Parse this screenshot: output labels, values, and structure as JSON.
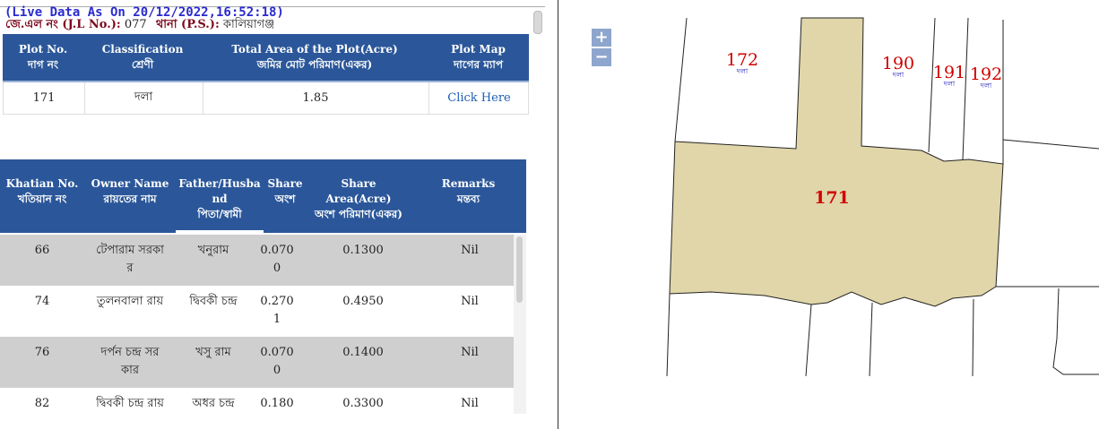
{
  "live_data": "(Live Data As On 20/12/2022,16:52:18)",
  "jl": {
    "jl_label": "জে.এল নং (J.L No.):",
    "jl_value": "077",
    "ps_label": "থানা (P.S.):",
    "ps_value": "কালিয়াগঞ্জ"
  },
  "plot_table": {
    "headers": [
      {
        "en": "Plot No.",
        "bn": "দাগ নং"
      },
      {
        "en": "Classification",
        "bn": "শ্রেণী"
      },
      {
        "en": "Total Area of the Plot(Acre)",
        "bn": "জমির মোট পরিমাণ(একর)"
      },
      {
        "en": "Plot Map",
        "bn": "দাগের ম্যাপ"
      }
    ],
    "row": {
      "plot_no": "171",
      "classification": "দলা",
      "area": "1.85",
      "map_link": "Click Here"
    }
  },
  "owner_table": {
    "headers": [
      {
        "en": "Khatian No.",
        "bn": "খতিয়ান নং"
      },
      {
        "en": "Owner Name",
        "bn": "রায়তের নাম"
      },
      {
        "en1": "Father/Husba",
        "en2": "nd",
        "bn": "পিতা/স্বামী"
      },
      {
        "en": "Share",
        "bn": "অংশ"
      },
      {
        "en": "Share Area(Acre)",
        "bn": "অংশ পরিমাণ(একর)"
      },
      {
        "en": "Remarks",
        "bn": "মন্তব্য"
      }
    ],
    "rows": [
      {
        "khatian": "66",
        "owner1": "টেপারাম সরকা",
        "owner2": "র",
        "father": "খনুরাম",
        "share1": "0.070",
        "share2": "0",
        "area": "0.1300",
        "remarks": "Nil"
      },
      {
        "khatian": "74",
        "owner1": "তুলনবালা রায়",
        "owner2": "",
        "father": "দ্বিবকী চন্দ্র",
        "share1": "0.270",
        "share2": "1",
        "area": "0.4950",
        "remarks": "Nil"
      },
      {
        "khatian": "76",
        "owner1": "দর্পন চন্দ্র সর",
        "owner2": "কার",
        "father": "খসু রাম",
        "share1": "0.070",
        "share2": "0",
        "area": "0.1400",
        "remarks": "Nil"
      },
      {
        "khatian": "82",
        "owner1": "দ্বিবকী চন্দ্র রায়",
        "owner2": "",
        "father": "অধর চন্দ্র",
        "share1": "0.180",
        "share2": "",
        "area": "0.3300",
        "remarks": "Nil"
      }
    ]
  },
  "map": {
    "zoom_in": "+",
    "zoom_out": "−",
    "highlight_color": "#e0d6a9",
    "plots": [
      {
        "number": "171",
        "class": ""
      },
      {
        "number": "172",
        "class": "দলা"
      },
      {
        "number": "190",
        "class": "দলা"
      },
      {
        "number": "191",
        "class": "দলা"
      },
      {
        "number": "192",
        "class": "দলা"
      }
    ]
  }
}
